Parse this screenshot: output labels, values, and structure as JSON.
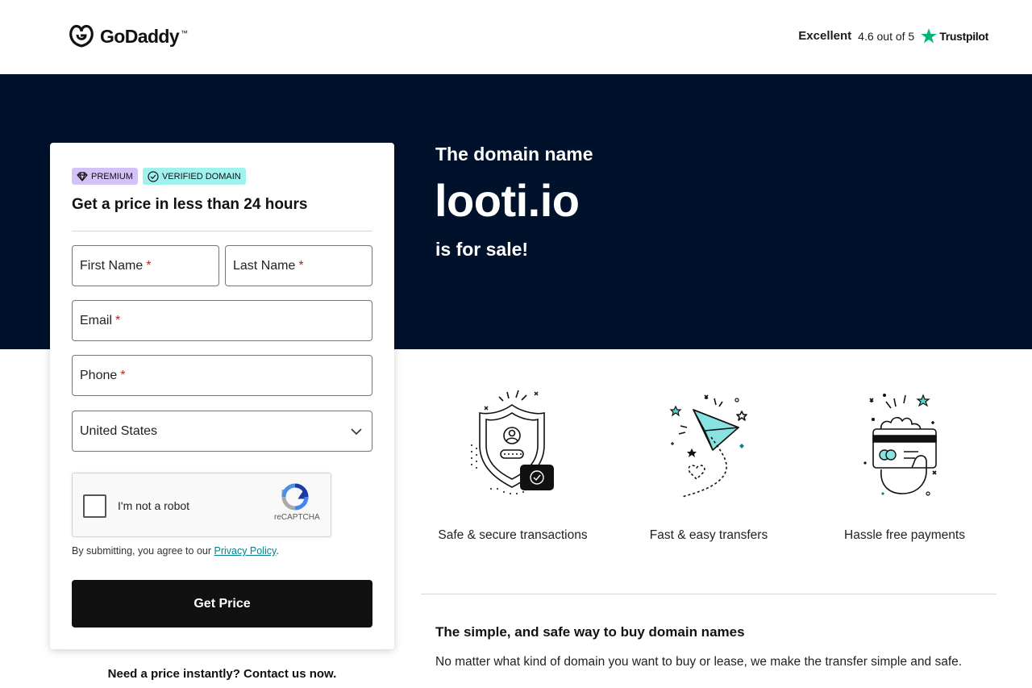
{
  "header": {
    "logo_text": "GoDaddy",
    "logo_tm": "™",
    "trust_excellent": "Excellent",
    "trust_rating": "4.6 out of 5",
    "trust_brand": "Trustpilot"
  },
  "hero": {
    "pre": "The domain name",
    "domain": "looti.io",
    "post": "is for sale!"
  },
  "form": {
    "badge_premium": "PREMIUM",
    "badge_verified": "VERIFIED DOMAIN",
    "title": "Get a price in less than 24 hours",
    "first_name": "First Name",
    "last_name": "Last Name",
    "email": "Email",
    "phone": "Phone",
    "required_mark": "*",
    "country": "United States",
    "captcha_label": "I'm not a robot",
    "captcha_brand": "reCAPTCHA",
    "terms_prefix": "By submitting, you agree to our ",
    "terms_link": "Privacy Policy",
    "terms_suffix": ".",
    "submit_label": "Get Price"
  },
  "contact": "Need a price instantly? Contact us now.",
  "features": [
    {
      "label": "Safe & secure transactions",
      "icon": "shield-icon"
    },
    {
      "label": "Fast & easy transfers",
      "icon": "paper-plane-icon"
    },
    {
      "label": "Hassle free payments",
      "icon": "card-payment-icon"
    }
  ],
  "info": {
    "title": "The simple, and safe way to buy domain names",
    "body": "No matter what kind of domain you want to buy or lease, we make the transfer simple and safe."
  },
  "colors": {
    "hero_bg": "#00112c",
    "premium_badge": "#d3c1f7",
    "verified_badge": "#a0f2ef",
    "button_bg": "#111111",
    "link": "#00838c",
    "trustpilot_star": "#00b67a",
    "required": "#db1802"
  }
}
